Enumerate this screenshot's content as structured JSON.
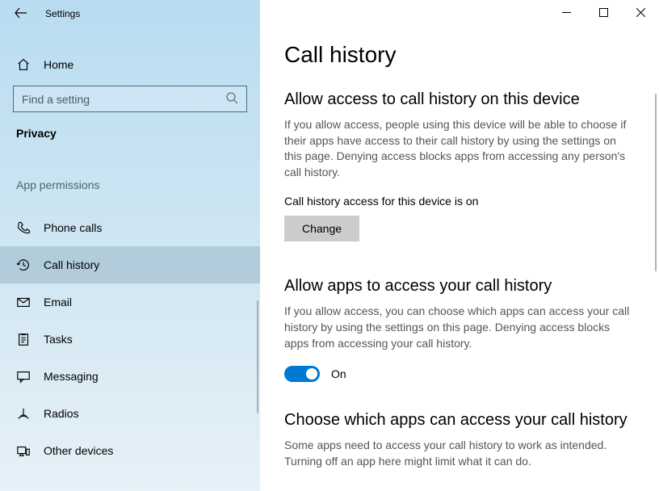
{
  "titlebar": {
    "appName": "Settings"
  },
  "sidebar": {
    "homeLabel": "Home",
    "searchPlaceholder": "Find a setting",
    "categoryLabel": "Privacy",
    "sectionLabel": "App permissions",
    "items": [
      {
        "label": "Phone calls"
      },
      {
        "label": "Call history"
      },
      {
        "label": "Email"
      },
      {
        "label": "Tasks"
      },
      {
        "label": "Messaging"
      },
      {
        "label": "Radios"
      },
      {
        "label": "Other devices"
      }
    ]
  },
  "page": {
    "title": "Call history",
    "section1": {
      "title": "Allow access to call history on this device",
      "body": "If you allow access, people using this device will be able to choose if their apps have access to their call history by using the settings on this page. Denying access blocks apps from accessing any person's call history.",
      "statusLine": "Call history access for this device is on",
      "changeLabel": "Change"
    },
    "section2": {
      "title": "Allow apps to access your call history",
      "body": "If you allow access, you can choose which apps can access your call history by using the settings on this page. Denying access blocks apps from accessing your call history.",
      "toggleState": "On"
    },
    "section3": {
      "title": "Choose which apps can access your call history",
      "body": "Some apps need to access your call history to work as intended. Turning off an app here might limit what it can do."
    }
  }
}
